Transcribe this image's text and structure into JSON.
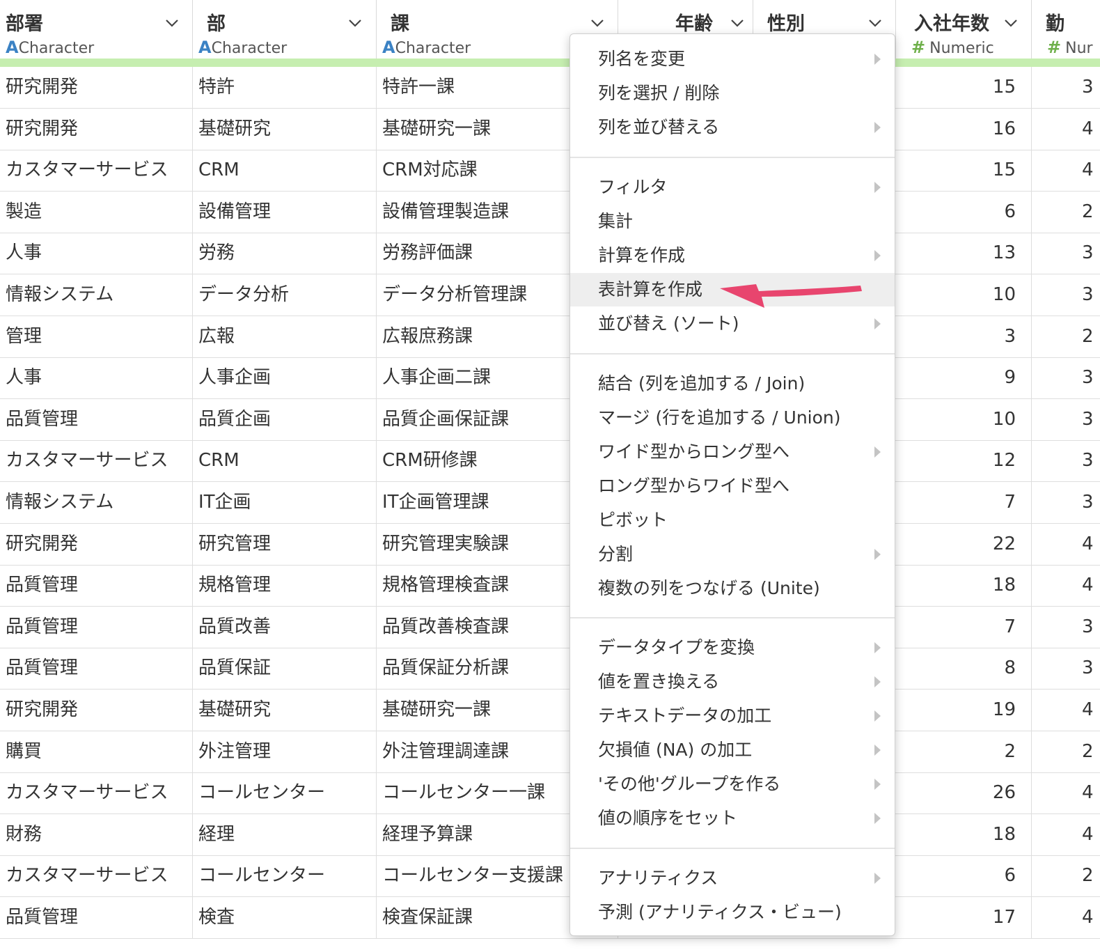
{
  "columns": [
    {
      "name": "部署",
      "type_icon": "A",
      "type": "Character"
    },
    {
      "name": "部",
      "type_icon": "A",
      "type": "Character"
    },
    {
      "name": "課",
      "type_icon": "A",
      "type": "Character"
    },
    {
      "name": "年齢",
      "type_icon": "",
      "type": ""
    },
    {
      "name": "性別",
      "type_icon": "",
      "type": ""
    },
    {
      "name": "入社年数",
      "type_icon": "#",
      "type": "Numeric"
    },
    {
      "name": "勤",
      "type_icon": "#",
      "type": "Nur"
    }
  ],
  "rows": [
    [
      "研究開発",
      "特許",
      "特許一課",
      "15",
      "3"
    ],
    [
      "研究開発",
      "基礎研究",
      "基礎研究一課",
      "16",
      "4"
    ],
    [
      "カスタマーサービス",
      "CRM",
      "CRM対応課",
      "15",
      "4"
    ],
    [
      "製造",
      "設備管理",
      "設備管理製造課",
      "6",
      "2"
    ],
    [
      "人事",
      "労務",
      "労務評価課",
      "13",
      "3"
    ],
    [
      "情報システム",
      "データ分析",
      "データ分析管理課",
      "10",
      "3"
    ],
    [
      "管理",
      "広報",
      "広報庶務課",
      "3",
      "2"
    ],
    [
      "人事",
      "人事企画",
      "人事企画二課",
      "9",
      "3"
    ],
    [
      "品質管理",
      "品質企画",
      "品質企画保証課",
      "10",
      "3"
    ],
    [
      "カスタマーサービス",
      "CRM",
      "CRM研修課",
      "12",
      "3"
    ],
    [
      "情報システム",
      "IT企画",
      "IT企画管理課",
      "7",
      "3"
    ],
    [
      "研究開発",
      "研究管理",
      "研究管理実験課",
      "22",
      "4"
    ],
    [
      "品質管理",
      "規格管理",
      "規格管理検査課",
      "18",
      "4"
    ],
    [
      "品質管理",
      "品質改善",
      "品質改善検査課",
      "7",
      "3"
    ],
    [
      "品質管理",
      "品質保証",
      "品質保証分析課",
      "8",
      "3"
    ],
    [
      "研究開発",
      "基礎研究",
      "基礎研究一課",
      "19",
      "4"
    ],
    [
      "購買",
      "外注管理",
      "外注管理調達課",
      "2",
      "2"
    ],
    [
      "カスタマーサービス",
      "コールセンター",
      "コールセンター一課",
      "26",
      "4"
    ],
    [
      "財務",
      "経理",
      "経理予算課",
      "18",
      "4"
    ],
    [
      "カスタマーサービス",
      "コールセンター",
      "コールセンター支援課",
      "6",
      "2"
    ],
    [
      "品質管理",
      "検査",
      "検査保証課",
      "17",
      "4"
    ]
  ],
  "menu": {
    "items": [
      {
        "label": "列名を変更",
        "submenu": true
      },
      {
        "label": "列を選択 / 削除",
        "submenu": false
      },
      {
        "label": "列を並び替える",
        "submenu": true
      },
      {
        "label": "フィルタ",
        "submenu": true
      },
      {
        "label": "集計",
        "submenu": false
      },
      {
        "label": "計算を作成",
        "submenu": true
      },
      {
        "label": "表計算を作成",
        "submenu": false,
        "highlighted": true
      },
      {
        "label": "並び替え (ソート)",
        "submenu": true
      },
      {
        "label": "結合 (列を追加する / Join)",
        "submenu": false
      },
      {
        "label": "マージ (行を追加する / Union)",
        "submenu": false
      },
      {
        "label": "ワイド型からロング型へ",
        "submenu": true
      },
      {
        "label": "ロング型からワイド型へ",
        "submenu": false
      },
      {
        "label": "ピボット",
        "submenu": false
      },
      {
        "label": "分割",
        "submenu": true
      },
      {
        "label": "複数の列をつなげる (Unite)",
        "submenu": false
      },
      {
        "label": "データタイプを変換",
        "submenu": true
      },
      {
        "label": "値を置き換える",
        "submenu": true
      },
      {
        "label": "テキストデータの加工",
        "submenu": true
      },
      {
        "label": "欠損値 (NA) の加工",
        "submenu": true
      },
      {
        "label": "'その他'グループを作る",
        "submenu": true
      },
      {
        "label": "値の順序をセット",
        "submenu": true
      },
      {
        "label": "アナリティクス",
        "submenu": true
      },
      {
        "label": "予測 (アナリティクス・ビュー)",
        "submenu": false
      }
    ]
  },
  "colors": {
    "accent_green": "#c6eeb0",
    "character_icon": "#3b82c4",
    "numeric_icon": "#6fb04b",
    "pointer_arrow": "#e8456e"
  },
  "icons": {
    "column_menu": "chevron-down-icon",
    "submenu": "submenu-arrow-icon",
    "pointer": "red-arrow-annotation"
  }
}
